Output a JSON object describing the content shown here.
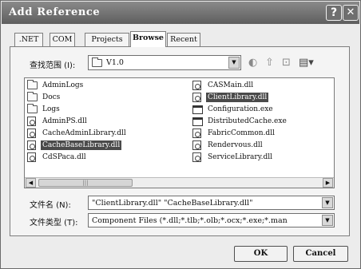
{
  "window": {
    "title": "Add Reference",
    "help_glyph": "?",
    "close_glyph": "✕"
  },
  "tabs": [
    {
      "label": ".NET",
      "active": false
    },
    {
      "label": "COM",
      "active": false
    },
    {
      "label": "Projects",
      "active": false
    },
    {
      "label": "Browse",
      "active": true
    },
    {
      "label": "Recent",
      "active": false
    }
  ],
  "lookin": {
    "label": "查找范围 (I):",
    "value": "V1.0"
  },
  "nav_icons": {
    "back": "◐",
    "up": "⇧",
    "new_folder": "⊡",
    "views": "▤▾"
  },
  "files": [
    {
      "name": "AdminLogs",
      "type": "folder",
      "selected": false
    },
    {
      "name": "Docs",
      "type": "folder",
      "selected": false
    },
    {
      "name": "Logs",
      "type": "folder",
      "selected": false
    },
    {
      "name": "AdminPS.dll",
      "type": "dll",
      "selected": false
    },
    {
      "name": "CacheAdminLibrary.dll",
      "type": "dll",
      "selected": false
    },
    {
      "name": "CacheBaseLibrary.dll",
      "type": "dll",
      "selected": true
    },
    {
      "name": "CdSPaca.dll",
      "type": "dll",
      "selected": false
    },
    {
      "name": "CASMain.dll",
      "type": "dll",
      "selected": false
    },
    {
      "name": "ClientLibrary.dll",
      "type": "dll",
      "selected": true
    },
    {
      "name": "Configuration.exe",
      "type": "exe",
      "selected": false
    },
    {
      "name": "DistributedCache.exe",
      "type": "exe",
      "selected": false
    },
    {
      "name": "FabricCommon.dll",
      "type": "dll",
      "selected": false
    },
    {
      "name": "Rendervous.dll",
      "type": "dll",
      "selected": false
    },
    {
      "name": "ServiceLibrary.dll",
      "type": "dll",
      "selected": false
    }
  ],
  "filename": {
    "label": "文件名 (N):",
    "value": "\"ClientLibrary.dll\" \"CacheBaseLibrary.dll\""
  },
  "filetype": {
    "label": "文件类型 (T):",
    "value": "Component Files (*.dll;*.tlb;*.olb;*.ocx;*.exe;*.man"
  },
  "buttons": {
    "ok": "OK",
    "cancel": "Cancel"
  },
  "scroll_glyphs": {
    "left": "◀",
    "right": "▶",
    "thumb": "|||"
  }
}
